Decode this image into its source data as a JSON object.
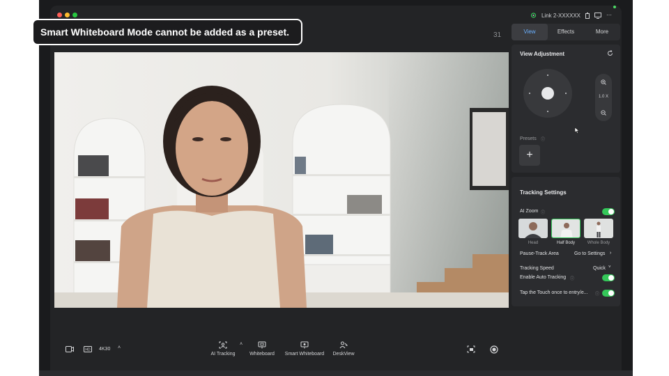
{
  "banner": {
    "text": "Smart Whiteboard Mode cannot be added as a preset."
  },
  "titlebar": {
    "device_label": "Link 2-XXXXXX",
    "icons": [
      "camera-device-icon",
      "chevron-down-icon",
      "battery-icon",
      "screen-icon",
      "more-icon"
    ]
  },
  "viewer": {
    "counter": "31"
  },
  "bottom_bar": {
    "resolution": "4K30",
    "modes": [
      {
        "label": "AI Tracking",
        "icon": "ai-tracking-icon"
      },
      {
        "label": "Whiteboard",
        "icon": "whiteboard-icon"
      },
      {
        "label": "Smart Whiteboard",
        "icon": "smart-whiteboard-icon"
      },
      {
        "label": "DeskView",
        "icon": "deskview-icon"
      }
    ]
  },
  "panel": {
    "tabs": [
      {
        "label": "View",
        "active": true
      },
      {
        "label": "Effects",
        "active": false
      },
      {
        "label": "More",
        "active": false
      }
    ],
    "view_adjustment": {
      "title": "View Adjustment",
      "zoom_label": "1.0 X",
      "presets_label": "Presets"
    },
    "tracking": {
      "title": "Tracking Settings",
      "ai_zoom_label": "AI Zoom",
      "ai_zoom_on": true,
      "framing": [
        {
          "label": "Head",
          "selected": false
        },
        {
          "label": "Half Body",
          "selected": true
        },
        {
          "label": "Whole Body",
          "selected": false
        }
      ],
      "pause_track_label": "Pause-Track Area",
      "pause_track_link": "Go to Settings",
      "speed_label": "Tracking Speed",
      "speed_value": "Quick",
      "auto_tracking_label": "Enable Auto Tracking",
      "auto_tracking_on": true,
      "touch_label": "Tap the Touch once to entry/e...",
      "touch_on": true
    }
  },
  "colors": {
    "accent": "#6ab0ff",
    "toggle_on": "#34c759",
    "background": "#232426"
  }
}
